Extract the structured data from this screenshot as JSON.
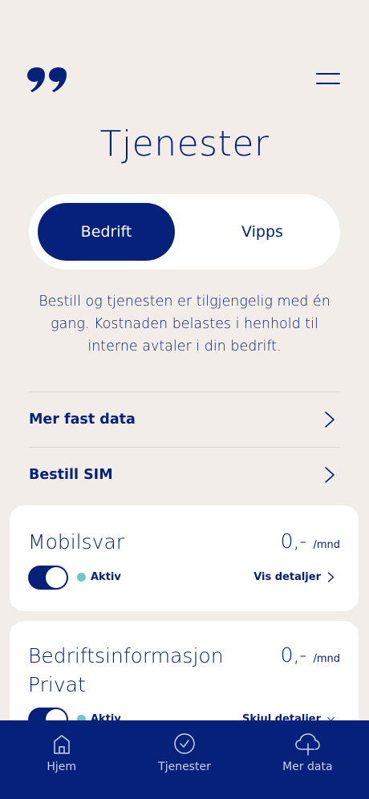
{
  "header": {
    "logo_icon": "quote-logo-icon",
    "menu_icon": "hamburger-menu-icon"
  },
  "page": {
    "title": "Tjenester"
  },
  "segmented": {
    "options": [
      {
        "label": "Bedrift",
        "active": true
      },
      {
        "label": "Vipps",
        "active": false
      }
    ]
  },
  "description": "Bestill og tjenesten er tilgjengelig med én gang. Kostnaden belastes i henhold til interne avtaler i din bedrift.",
  "links": [
    {
      "label": "Mer fast data"
    },
    {
      "label": "Bestill SIM"
    }
  ],
  "services": [
    {
      "title": "Mobilsvar",
      "price": "0,-",
      "unit": "/mnd",
      "enabled": true,
      "status": "Aktiv",
      "details_label": "Vis detaljer"
    },
    {
      "title": "Bedriftsinformasjon Privat",
      "price": "0,-",
      "unit": "/mnd",
      "enabled": true,
      "status": "Aktiv",
      "details_label": "Skjul detaljer"
    }
  ],
  "nav": [
    {
      "label": "Hjem",
      "icon": "home-icon"
    },
    {
      "label": "Tjenester",
      "icon": "check-circle-icon"
    },
    {
      "label": "Mer data",
      "icon": "cloud-plus-icon"
    }
  ],
  "colors": {
    "primary": "#06217a",
    "background": "#f2ede8",
    "card": "#ffffff",
    "status_active": "#6ec7c2"
  }
}
